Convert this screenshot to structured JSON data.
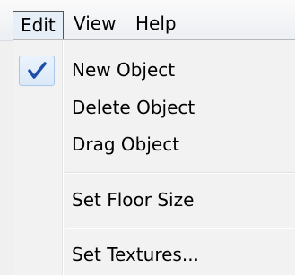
{
  "menubar": {
    "items": [
      {
        "label": "Edit"
      },
      {
        "label": "View"
      },
      {
        "label": "Help"
      }
    ]
  },
  "dropdown": {
    "items": [
      {
        "label": "New Object",
        "checked": true
      },
      {
        "label": "Delete Object",
        "checked": false
      },
      {
        "label": "Drag Object",
        "checked": false
      },
      {
        "label": "Set Floor Size",
        "checked": false
      },
      {
        "label": "Set Textures...",
        "checked": false
      }
    ],
    "check_icon": "checkmark-icon",
    "check_color": "#1c4fa8"
  }
}
